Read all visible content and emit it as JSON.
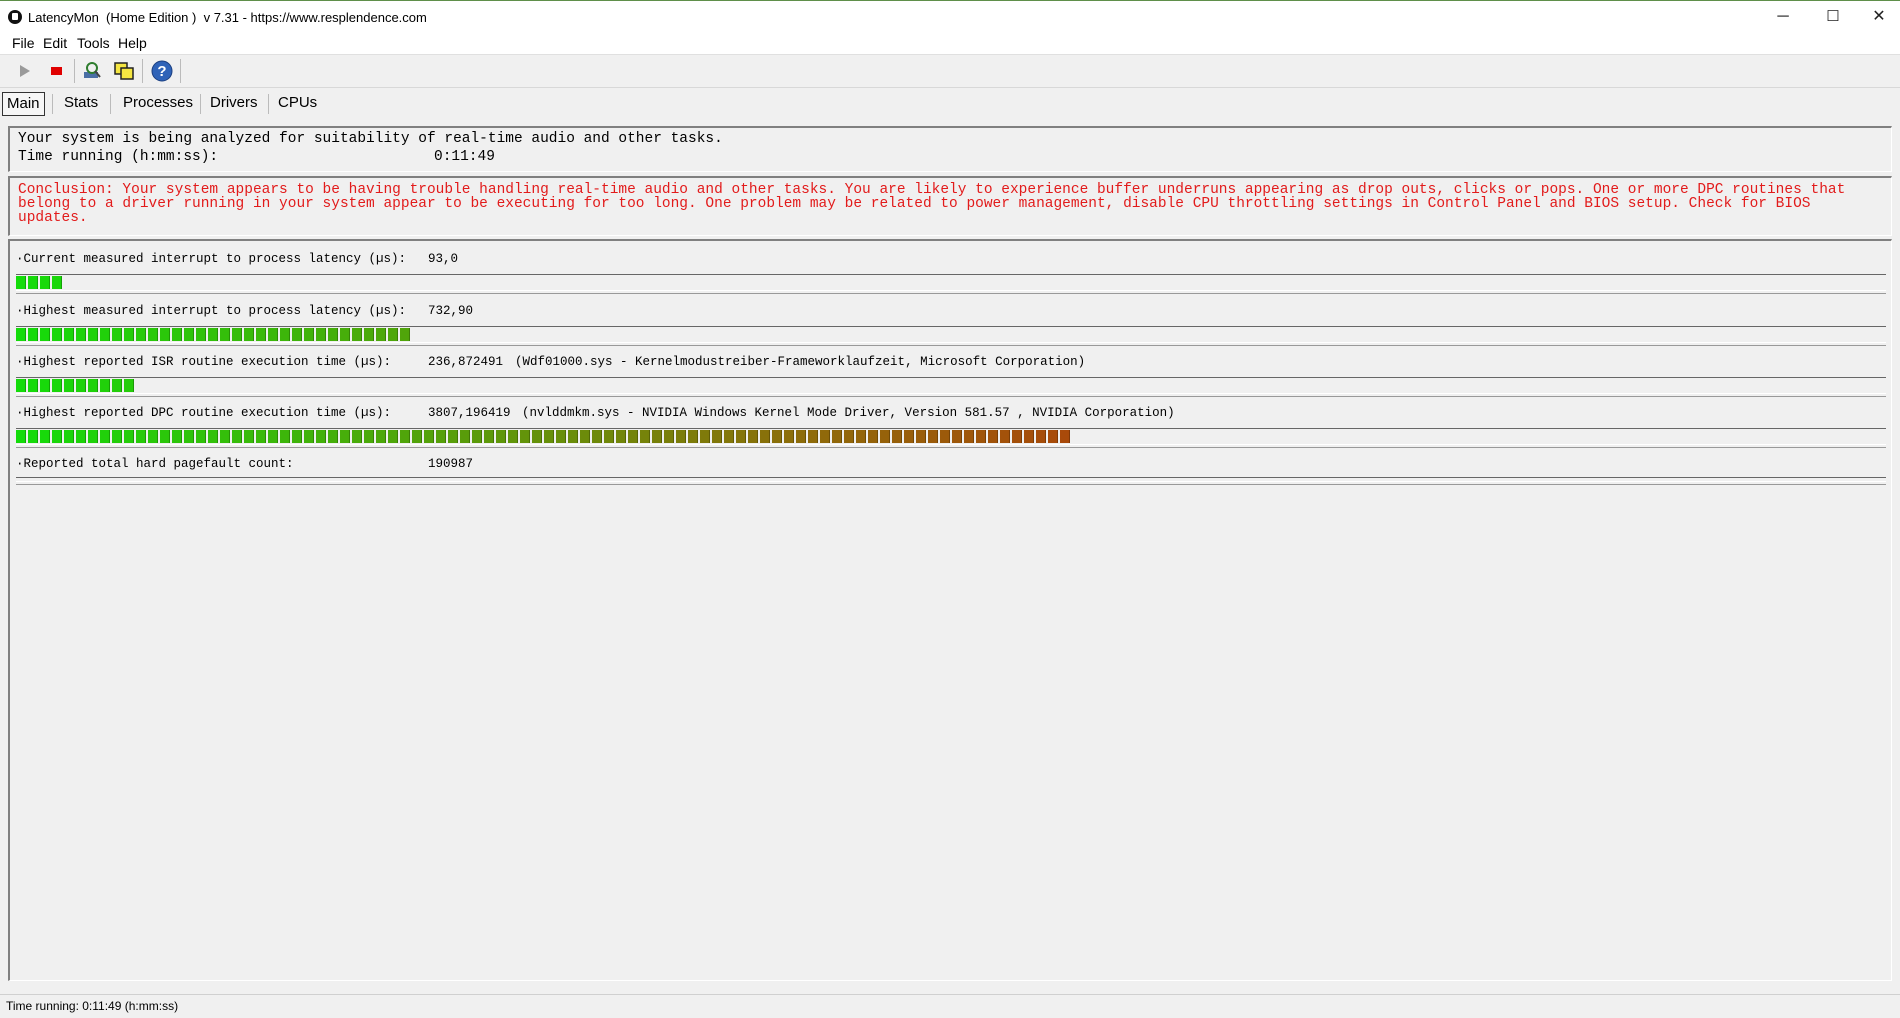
{
  "window": {
    "title": "LatencyMon  (Home Edition )  v 7.31 - https://www.resplendence.com",
    "minimize": "─",
    "maximize": "☐",
    "close": "✕"
  },
  "menu": {
    "file": "File",
    "edit": "Edit",
    "tools": "Tools",
    "help": "Help"
  },
  "toolbar": {
    "start_icon": "play-icon",
    "stop_icon": "stop-icon",
    "analyze_icon": "analyze-icon",
    "windows_icon": "windows-icon",
    "help_icon": "help-icon",
    "help_glyph": "?"
  },
  "tabs": [
    "Main",
    "Stats",
    "Processes",
    "Drivers",
    "CPUs"
  ],
  "status": {
    "message": "Your system is being analyzed for suitability of real-time audio and other tasks.",
    "time_label": "Time running (h:mm:ss):",
    "time_value": "0:11:49"
  },
  "conclusion": "Conclusion: Your system appears to be having trouble handling real-time audio and other tasks. You are likely to experience buffer underruns appearing as drop outs, clicks or pops. One or more DPC routines that belong to a driver running in your system appear to be executing for too long. One problem may be related to power management, disable CPU throttling settings in Control Panel and BIOS setup. Check for BIOS updates.",
  "conclusion_color": "#e21b1b",
  "metrics": [
    {
      "label": "·Current measured interrupt to process latency (µs):",
      "value": "93,0",
      "detail": "",
      "bar_segments": 4
    },
    {
      "label": "·Highest measured interrupt to process latency (µs):",
      "value": "732,90",
      "detail": "",
      "bar_segments": 33
    },
    {
      "label": "·Highest reported ISR routine execution time (µs):",
      "value": "236,872491",
      "detail": "(Wdf01000.sys - Kernelmodustreiber-Frameworklaufzeit, Microsoft Corporation)",
      "bar_segments": 10
    },
    {
      "label": "·Highest reported DPC routine execution time (µs):",
      "value": "3807,196419",
      "detail": "(nvlddmkm.sys - NVIDIA Windows Kernel Mode Driver, Version 581.57 , NVIDIA Corporation)",
      "bar_segments": 88
    },
    {
      "label": "·Reported total hard pagefault count:",
      "value": "190987",
      "detail": "",
      "bar_segments": 0
    }
  ],
  "statusbar": "Time running: 0:11:49  (h:mm:ss)"
}
